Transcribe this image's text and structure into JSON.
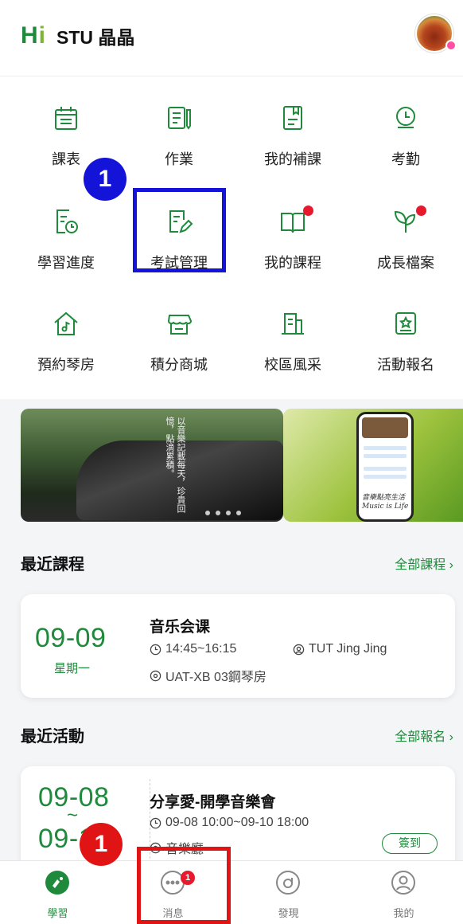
{
  "header": {
    "logo_h": "H",
    "logo_i": "i",
    "user_name": "STU 晶晶"
  },
  "menu": [
    {
      "label": "課表",
      "icon": "calendar-icon"
    },
    {
      "label": "作業",
      "icon": "homework-icon"
    },
    {
      "label": "我的補課",
      "icon": "bookmark-doc-icon"
    },
    {
      "label": "考勤",
      "icon": "attendance-clock-icon"
    },
    {
      "label": "學習進度",
      "icon": "progress-doc-icon"
    },
    {
      "label": "考試管理",
      "icon": "exam-edit-icon"
    },
    {
      "label": "我的課程",
      "icon": "book-open-icon",
      "dot": true
    },
    {
      "label": "成長檔案",
      "icon": "sprout-icon",
      "dot": true
    },
    {
      "label": "預約琴房",
      "icon": "music-house-icon"
    },
    {
      "label": "積分商城",
      "icon": "store-icon"
    },
    {
      "label": "校區風采",
      "icon": "campus-icon"
    },
    {
      "label": "活動報名",
      "icon": "badge-star-icon"
    }
  ],
  "banner": {
    "poem": "以音樂記載每天，珍貴回憶，點滴累積。",
    "phone_caption_1": "音樂點亮生活",
    "phone_caption_2": "Music is Life"
  },
  "recent_courses": {
    "title": "最近課程",
    "link": "全部課程",
    "course": {
      "date": "09-09",
      "weekday": "星期一",
      "name": "音乐会课",
      "time": "14:45~16:15",
      "teacher": "TUT Jing Jing",
      "room": "UAT-XB 03鋼琴房"
    }
  },
  "recent_events": {
    "title": "最近活動",
    "link": "全部報名",
    "event": {
      "date_start": "09-08",
      "tilde": "~",
      "date_end": "09-10",
      "name": "分享愛-開學音樂會",
      "time": "09-08 10:00~09-10 18:00",
      "venue": "音樂廳",
      "button": "簽到"
    }
  },
  "tabbar": [
    {
      "label": "學習",
      "icon": "study-icon",
      "active": true
    },
    {
      "label": "消息",
      "icon": "message-icon",
      "badge": "1"
    },
    {
      "label": "發現",
      "icon": "discover-icon"
    },
    {
      "label": "我的",
      "icon": "profile-icon"
    }
  ],
  "annotations": {
    "blue_step": "1",
    "red_step": "1"
  },
  "colors": {
    "brand_green": "#1f8a3b",
    "accent_red": "#e8192c",
    "annotation_blue": "#1414d8",
    "annotation_red": "#e01414"
  }
}
